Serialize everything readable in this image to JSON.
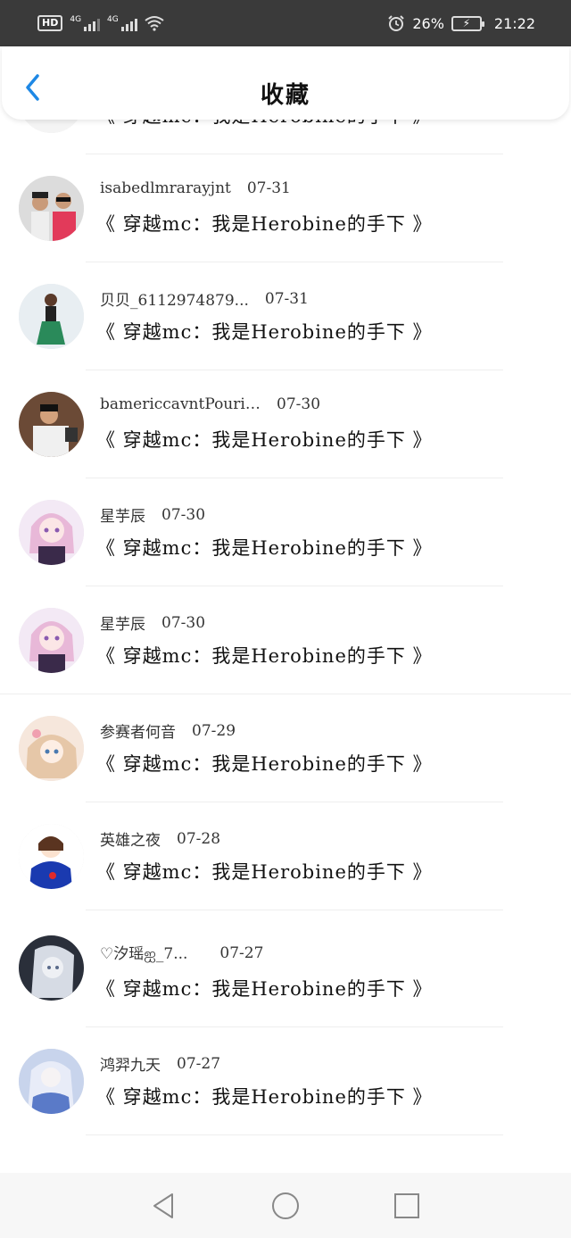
{
  "status_bar": {
    "hd": "HD",
    "net1": "4G",
    "net2": "4G",
    "battery_percent": "26%",
    "time": "21:22",
    "icons": [
      "alarm-icon",
      "wifi-icon",
      "battery-icon"
    ]
  },
  "header": {
    "title": "收藏",
    "back_icon": "chevron-left-icon",
    "accent_color": "#1e88e5"
  },
  "items": [
    {
      "name": "",
      "date": "",
      "title": "《 穿越mc：我是Herobine的手下 》"
    },
    {
      "name": "isabedlmrarayjnt",
      "date": "07-31",
      "title": "《 穿越mc：我是Herobine的手下 》"
    },
    {
      "name": "贝贝_6112974879...",
      "date": "07-31",
      "title": "《 穿越mc：我是Herobine的手下 》"
    },
    {
      "name": "bamericcavntPourister",
      "date": "07-30",
      "title": "《 穿越mc：我是Herobine的手下 》"
    },
    {
      "name": "星芋辰",
      "date": "07-30",
      "title": "《 穿越mc：我是Herobine的手下 》"
    },
    {
      "name": "星芋辰",
      "date": "07-30",
      "title": "《 穿越mc：我是Herobine的手下 》"
    },
    {
      "name": "参赛者何音",
      "date": "07-29",
      "title": "《 穿越mc：我是Herobine的手下 》"
    },
    {
      "name": "英雄之夜",
      "date": "07-28",
      "title": "《 穿越mc：我是Herobine的手下 》"
    },
    {
      "name": "♡汐瑶ஐ_7...",
      "date": "07-27",
      "title": "《 穿越mc：我是Herobine的手下 》"
    },
    {
      "name": "鸿羿九天",
      "date": "07-27",
      "title": "《 穿越mc：我是Herobine的手下 》"
    }
  ],
  "nav": {
    "back_icon": "triangle-back-icon",
    "home_icon": "circle-home-icon",
    "recents_icon": "square-recents-icon"
  }
}
